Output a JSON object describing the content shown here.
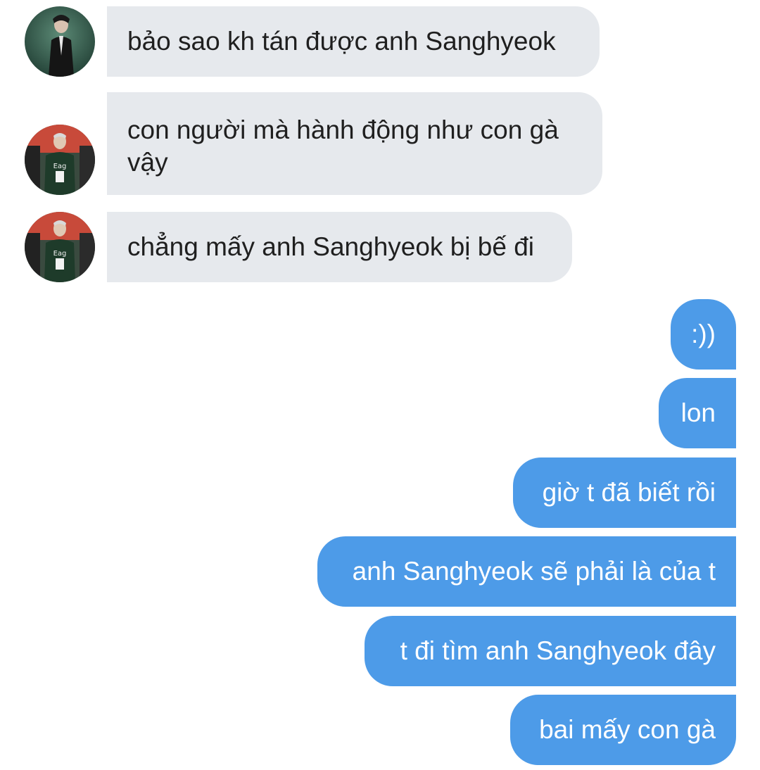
{
  "conversation": {
    "incoming": [
      {
        "avatar": "avatar-icon",
        "text": "bảo sao kh tán được anh Sanghyeok"
      },
      {
        "avatar": "avatar-icon",
        "text": "con người mà hành động như con gà vậy"
      },
      {
        "avatar": "avatar-icon",
        "text": "chẳng mấy anh Sanghyeok bị bế đi"
      }
    ],
    "outgoing": [
      {
        "text": ":))"
      },
      {
        "text": "lon"
      },
      {
        "text": "giờ t đã biết rồi"
      },
      {
        "text": "anh Sanghyeok sẽ phải là của t"
      },
      {
        "text": "t đi tìm anh Sanghyeok đây"
      },
      {
        "text": "bai mấy con gà"
      }
    ]
  },
  "colors": {
    "incoming_bubble": "#e6e9ed",
    "outgoing_bubble": "#4d9be8",
    "incoming_text": "#1f1f1f",
    "outgoing_text": "#ffffff"
  }
}
